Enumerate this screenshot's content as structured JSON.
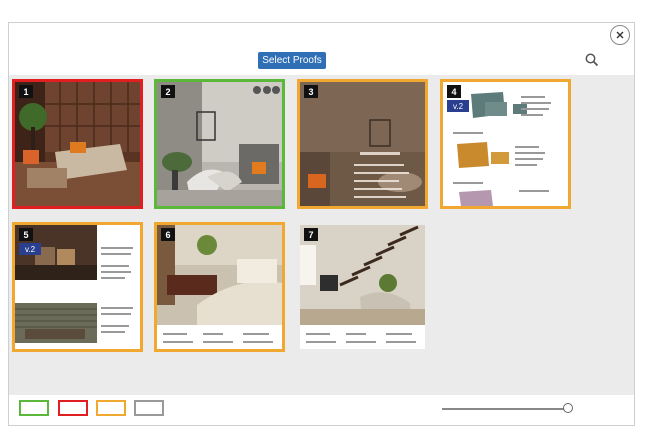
{
  "header": {
    "select_proofs_label": "Select Proofs",
    "search_icon": "search-icon",
    "close_icon": "close-icon"
  },
  "proofs": [
    {
      "number": "1",
      "status": "rejected",
      "version": ""
    },
    {
      "number": "2",
      "status": "approved",
      "version": ""
    },
    {
      "number": "3",
      "status": "pending",
      "version": ""
    },
    {
      "number": "4",
      "status": "pending",
      "version": "v.2"
    },
    {
      "number": "5",
      "status": "pending",
      "version": "v.2"
    },
    {
      "number": "6",
      "status": "pending",
      "version": ""
    },
    {
      "number": "7",
      "status": "none",
      "version": ""
    }
  ],
  "filters": [
    {
      "name": "approved",
      "color": "#5cb83a"
    },
    {
      "name": "rejected",
      "color": "#e02020"
    },
    {
      "name": "pending",
      "color": "#f0a830"
    },
    {
      "name": "none",
      "color": "#999999"
    }
  ],
  "zoom": {
    "value": 1.0
  }
}
